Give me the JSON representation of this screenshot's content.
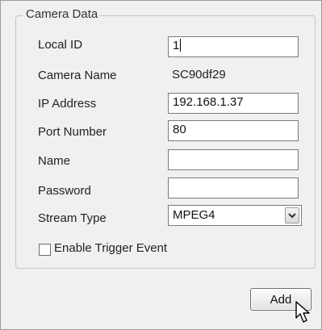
{
  "group": {
    "title": "Camera Data"
  },
  "fields": {
    "local_id": {
      "label": "Local ID",
      "value": "1"
    },
    "camera_name": {
      "label": "Camera Name",
      "value": "SC90df29"
    },
    "ip_address": {
      "label": "IP Address",
      "value": "192.168.1.37"
    },
    "port_number": {
      "label": "Port Number",
      "value": "80"
    },
    "name": {
      "label": "Name",
      "value": ""
    },
    "password": {
      "label": "Password",
      "value": ""
    },
    "stream_type": {
      "label": "Stream Type",
      "value": "MPEG4"
    }
  },
  "trigger": {
    "label": "Enable Trigger Event",
    "checked": false
  },
  "buttons": {
    "add_label": "Add"
  },
  "icons": {
    "dropdown": "chevron-down-icon",
    "cursor": "mouse-pointer-icon"
  }
}
